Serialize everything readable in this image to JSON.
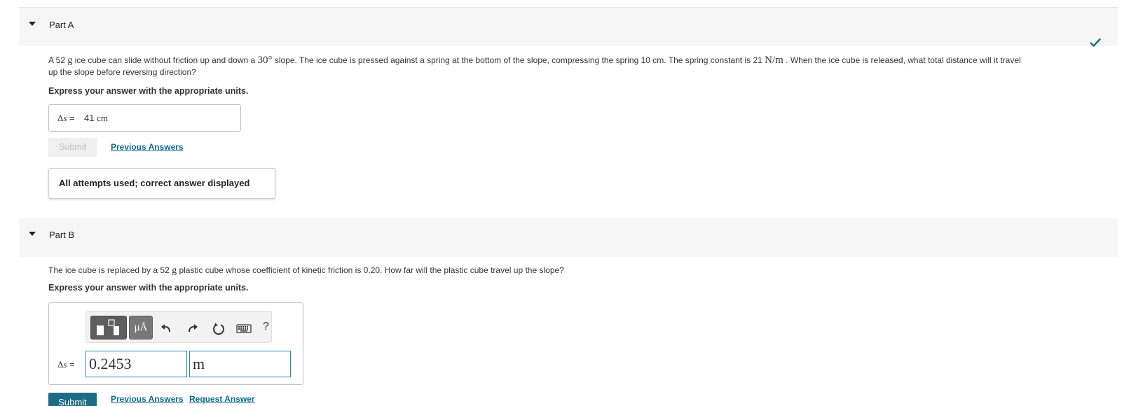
{
  "partA": {
    "title": "Part A",
    "question_pre": "A 52 ",
    "q_g": "g",
    "question_mid1": " ice cube can slide without friction up and down a ",
    "q_angle": "30°",
    "question_mid2": " slope. The ice cube is pressed against a spring at the bottom of the slope, compressing the spring 10 cm. The spring constant is 21 ",
    "q_unit": "N/m",
    "question_post1": " . When the ice cube is released, what total distance will it travel",
    "question_post2": "up the slope before reversing direction?",
    "express": "Express your answer with the appropriate units.",
    "answer_label_delta": "Δ",
    "answer_label_s": "s",
    "answer_label_eq": " =",
    "answer_value": "41",
    "answer_unit": "cm",
    "submit_label": "Submit",
    "previous_answers": "Previous Answers",
    "feedback": "All attempts used; correct answer displayed"
  },
  "partB": {
    "title": "Part B",
    "question_pre": "The ice cube is replaced by a 52 ",
    "q_g": "g",
    "question_post": " plastic cube whose coefficient of kinetic friction is 0.20. How far will the plastic cube travel up the slope?",
    "express": "Express your answer with the appropriate units.",
    "toolbar": {
      "units_button": "μÅ",
      "help": "?"
    },
    "input_label_delta": "Δ",
    "input_label_s": "s",
    "input_label_eq": " =",
    "input_value": "0.2453",
    "unit_value": "m",
    "submit_label": "Submit",
    "previous_answers": "Previous Answers",
    "request_answer": "Request Answer"
  },
  "colors": {
    "link": "#0e6c8f",
    "submit_bg": "#1b6d85",
    "check": "#1b6d85",
    "field_border": "#1c8fa3"
  },
  "icons": [
    "caret-down-icon",
    "checkmark-icon",
    "template-icon",
    "undo-icon",
    "redo-icon",
    "reset-icon",
    "keyboard-icon"
  ]
}
